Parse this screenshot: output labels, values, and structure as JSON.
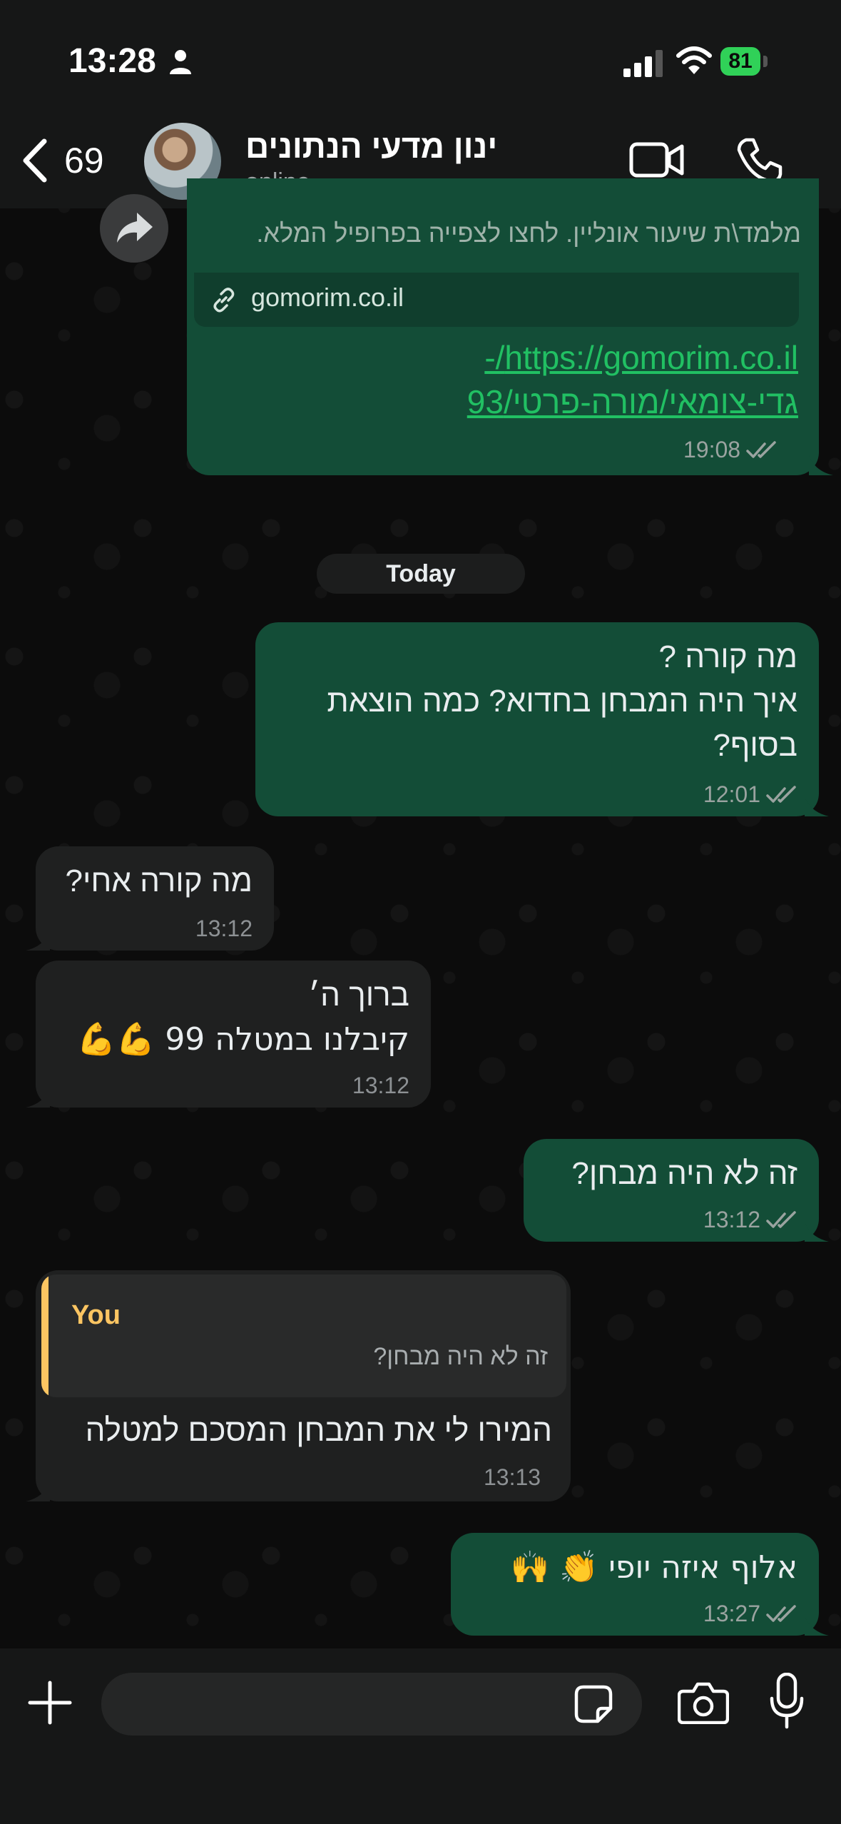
{
  "status_bar": {
    "time": "13:28",
    "battery": "81"
  },
  "header": {
    "back_count": "69",
    "contact_name": "ינון מדעי הנתונים",
    "contact_status": "online"
  },
  "messages": {
    "link_message": {
      "preview_description": "מלמד\\ת שיעור אונליין. לחצו לצפייה בפרופיל המלא.",
      "preview_domain": "gomorim.co.il",
      "link_text": "https://gomorim.co.il/-גדי-צומאי/מורה-פרטי/93",
      "time": "19:08"
    },
    "date_divider": "Today",
    "m1": {
      "text_line1": "מה קורה ?",
      "text_line2": "איך היה המבחן בחדוא? כמה הוצאת",
      "text_line3": "בסוף?",
      "time": "12:01"
    },
    "m2": {
      "text": "מה קורה אחי?",
      "time": "13:12"
    },
    "m3": {
      "text_line1": "ברוך ה׳",
      "text_line2": "קיבלנו במטלה 99 💪💪",
      "time": "13:12"
    },
    "m4": {
      "text": "זה לא היה מבחן?",
      "time": "13:12"
    },
    "m5": {
      "quote_sender": "You",
      "quote_text": "זה לא היה מבחן?",
      "text": "המירו לי את המבחן המסכם למטלה",
      "time": "13:13"
    },
    "m6": {
      "text": "אלוף איזה יופי 👏 🙌",
      "time": "13:27"
    }
  },
  "composer": {
    "placeholder": ""
  },
  "colors": {
    "outgoing_bubble": "#134d37",
    "incoming_bubble": "#1f2020",
    "link": "#21c063",
    "quote_accent": "#fcc562",
    "battery": "#30d158"
  },
  "icons": [
    "person-icon",
    "signal-icon",
    "wifi-icon",
    "back-chevron-icon",
    "video-call-icon",
    "phone-icon",
    "forward-icon",
    "link-icon",
    "double-check-icon",
    "plus-icon",
    "sticker-icon",
    "camera-icon",
    "microphone-icon"
  ]
}
